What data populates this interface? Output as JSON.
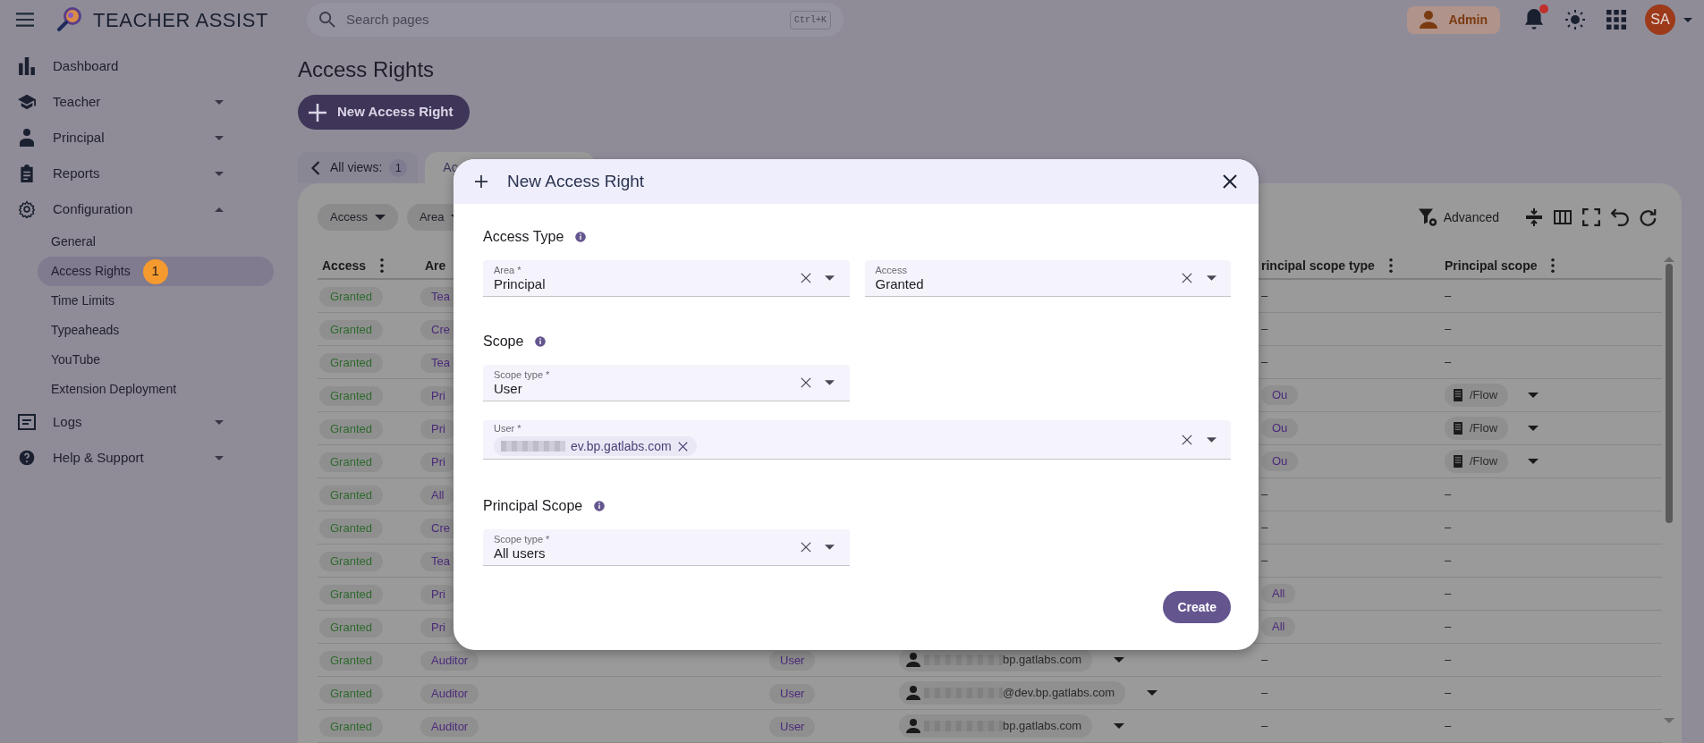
{
  "topbar": {
    "app_title": "TEACHER ASSIST",
    "search": {
      "placeholder": "Search pages",
      "shortcut": "Ctrl+K"
    },
    "role": "Admin",
    "notifications": {
      "unread": true
    },
    "avatar": "SA"
  },
  "sidebar": {
    "items": [
      {
        "label": "Dashboard",
        "selected": false
      },
      {
        "label": "Teacher",
        "selected": false,
        "expanded": false
      },
      {
        "label": "Principal",
        "selected": false,
        "expanded": false
      },
      {
        "label": "Reports",
        "selected": false,
        "expanded": false
      },
      {
        "label": "Configuration",
        "selected": false,
        "expanded": true,
        "children": [
          {
            "label": "General",
            "selected": false
          },
          {
            "label": "Access Rights",
            "selected": true,
            "badge": "1"
          },
          {
            "label": "Time Limits",
            "selected": false
          },
          {
            "label": "Typeaheads",
            "selected": false
          },
          {
            "label": "YouTube",
            "selected": false
          },
          {
            "label": "Extension Deployment",
            "selected": false
          }
        ]
      },
      {
        "label": "Logs",
        "selected": false,
        "expanded": false
      },
      {
        "label": "Help & Support",
        "selected": false,
        "expanded": false
      }
    ]
  },
  "page": {
    "title": "Access Rights",
    "new_button": "New Access Right"
  },
  "views": {
    "label": "All views:",
    "count": "1",
    "tabs": [
      {
        "label": "Ac",
        "selected": true
      }
    ]
  },
  "filters": [
    {
      "label": "Access"
    },
    {
      "label": "Area"
    }
  ],
  "toolbar": {
    "advanced": "Advanced"
  },
  "table": {
    "columns": [
      {
        "label": "Access",
        "menu": true
      },
      {
        "label": "Are",
        "menu": false
      },
      {
        "label": "rincipal scope type",
        "menu": true
      },
      {
        "label": "Principal scope",
        "menu": true
      }
    ],
    "rows": [
      {
        "access": "Granted",
        "area": "Tea",
        "principal_scope_type": {
          "kind": "plain",
          "text": "–"
        },
        "principal_scope": {
          "kind": "plain",
          "text": "–"
        }
      },
      {
        "access": "Granted",
        "area": "Cre",
        "principal_scope_type": {
          "kind": "plain",
          "text": "–"
        },
        "principal_scope": {
          "kind": "plain",
          "text": "–"
        }
      },
      {
        "access": "Granted",
        "area": "Tea",
        "principal_scope_type": {
          "kind": "plain",
          "text": "–"
        },
        "principal_scope": {
          "kind": "plain",
          "text": "–"
        }
      },
      {
        "access": "Granted",
        "area": "Pri",
        "principal_scope_type": {
          "kind": "tag",
          "text": "Ou"
        },
        "principal_scope": {
          "kind": "org",
          "text": "/Flow"
        }
      },
      {
        "access": "Granted",
        "area": "Pri",
        "principal_scope_type": {
          "kind": "tag",
          "text": "Ou"
        },
        "principal_scope": {
          "kind": "org",
          "text": "/Flow"
        }
      },
      {
        "access": "Granted",
        "area": "Pri",
        "principal_scope_type": {
          "kind": "tag",
          "text": "Ou"
        },
        "principal_scope": {
          "kind": "org",
          "text": "/Flow"
        }
      },
      {
        "access": "Granted",
        "area": "All",
        "principal_scope_type": {
          "kind": "plain",
          "text": "–"
        },
        "principal_scope": {
          "kind": "plain",
          "text": "–"
        }
      },
      {
        "access": "Granted",
        "area": "Cre",
        "principal_scope_type": {
          "kind": "plain",
          "text": "–"
        },
        "principal_scope": {
          "kind": "plain",
          "text": "–"
        }
      },
      {
        "access": "Granted",
        "area": "Tea",
        "principal_scope_type": {
          "kind": "plain",
          "text": "–"
        },
        "principal_scope": {
          "kind": "plain",
          "text": "–"
        }
      },
      {
        "access": "Granted",
        "area": "Pri",
        "principal_scope_type": {
          "kind": "tag",
          "text": "All"
        },
        "principal_scope": {
          "kind": "plain",
          "text": "–"
        }
      },
      {
        "access": "Granted",
        "area": "Pri",
        "principal_scope_type": {
          "kind": "tag",
          "text": "All"
        },
        "principal_scope": {
          "kind": "plain",
          "text": "–"
        }
      },
      {
        "access": "Granted",
        "area": "Auditor",
        "scope_type": "User",
        "scope": "bp.gatlabs.com",
        "principal_scope_type": {
          "kind": "plain",
          "text": "–"
        },
        "principal_scope": {
          "kind": "plain",
          "text": "–"
        }
      },
      {
        "access": "Granted",
        "area": "Auditor",
        "scope_type": "User",
        "scope": "@dev.bp.gatlabs.com",
        "principal_scope_type": {
          "kind": "plain",
          "text": "–"
        },
        "principal_scope": {
          "kind": "plain",
          "text": "–"
        }
      },
      {
        "access": "Granted",
        "area": "Auditor",
        "scope_type": "User",
        "scope": "bp.gatlabs.com",
        "principal_scope_type": {
          "kind": "plain",
          "text": "–"
        },
        "principal_scope": {
          "kind": "plain",
          "text": "–"
        }
      }
    ]
  },
  "dialog": {
    "title": "New Access Right",
    "sections": [
      {
        "heading": "Access Type",
        "fields": [
          {
            "kind": "select",
            "label": "Area *",
            "value": "Principal"
          },
          {
            "kind": "select",
            "label": "Access",
            "value": "Granted"
          }
        ]
      },
      {
        "heading": "Scope",
        "fields": [
          {
            "kind": "select",
            "label": "Scope type *",
            "value": "User"
          },
          {
            "kind": "chips",
            "label": "User *",
            "chips": [
              "ev.bp.gatlabs.com"
            ]
          }
        ]
      },
      {
        "heading": "Principal Scope",
        "fields": [
          {
            "kind": "select",
            "label": "Scope type *",
            "value": "All users"
          }
        ]
      }
    ],
    "create_button": "Create"
  }
}
